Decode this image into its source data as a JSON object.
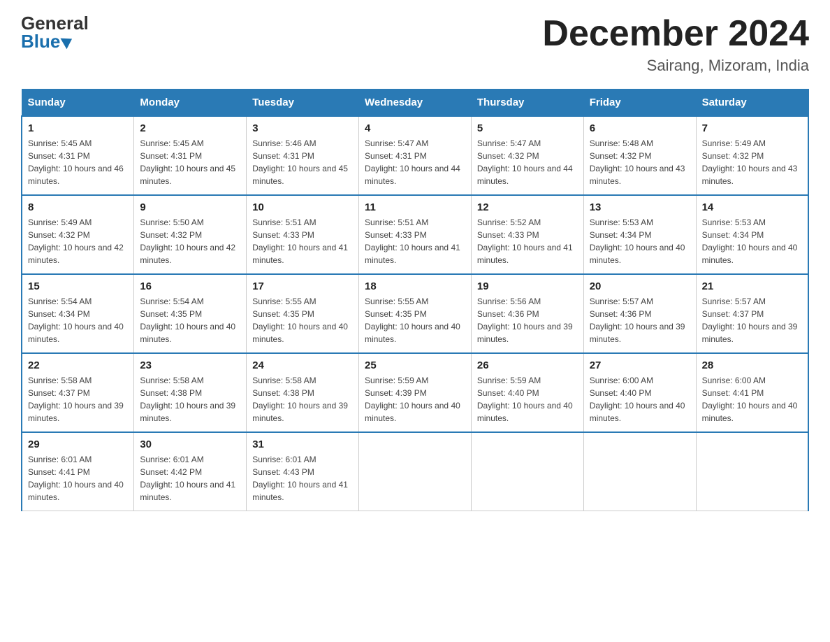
{
  "header": {
    "logo_line1": "General",
    "logo_line2": "Blue",
    "month_title": "December 2024",
    "location": "Sairang, Mizoram, India"
  },
  "weekdays": [
    "Sunday",
    "Monday",
    "Tuesday",
    "Wednesday",
    "Thursday",
    "Friday",
    "Saturday"
  ],
  "weeks": [
    [
      {
        "day": "1",
        "sunrise": "5:45 AM",
        "sunset": "4:31 PM",
        "daylight": "10 hours and 46 minutes."
      },
      {
        "day": "2",
        "sunrise": "5:45 AM",
        "sunset": "4:31 PM",
        "daylight": "10 hours and 45 minutes."
      },
      {
        "day": "3",
        "sunrise": "5:46 AM",
        "sunset": "4:31 PM",
        "daylight": "10 hours and 45 minutes."
      },
      {
        "day": "4",
        "sunrise": "5:47 AM",
        "sunset": "4:31 PM",
        "daylight": "10 hours and 44 minutes."
      },
      {
        "day": "5",
        "sunrise": "5:47 AM",
        "sunset": "4:32 PM",
        "daylight": "10 hours and 44 minutes."
      },
      {
        "day": "6",
        "sunrise": "5:48 AM",
        "sunset": "4:32 PM",
        "daylight": "10 hours and 43 minutes."
      },
      {
        "day": "7",
        "sunrise": "5:49 AM",
        "sunset": "4:32 PM",
        "daylight": "10 hours and 43 minutes."
      }
    ],
    [
      {
        "day": "8",
        "sunrise": "5:49 AM",
        "sunset": "4:32 PM",
        "daylight": "10 hours and 42 minutes."
      },
      {
        "day": "9",
        "sunrise": "5:50 AM",
        "sunset": "4:32 PM",
        "daylight": "10 hours and 42 minutes."
      },
      {
        "day": "10",
        "sunrise": "5:51 AM",
        "sunset": "4:33 PM",
        "daylight": "10 hours and 41 minutes."
      },
      {
        "day": "11",
        "sunrise": "5:51 AM",
        "sunset": "4:33 PM",
        "daylight": "10 hours and 41 minutes."
      },
      {
        "day": "12",
        "sunrise": "5:52 AM",
        "sunset": "4:33 PM",
        "daylight": "10 hours and 41 minutes."
      },
      {
        "day": "13",
        "sunrise": "5:53 AM",
        "sunset": "4:34 PM",
        "daylight": "10 hours and 40 minutes."
      },
      {
        "day": "14",
        "sunrise": "5:53 AM",
        "sunset": "4:34 PM",
        "daylight": "10 hours and 40 minutes."
      }
    ],
    [
      {
        "day": "15",
        "sunrise": "5:54 AM",
        "sunset": "4:34 PM",
        "daylight": "10 hours and 40 minutes."
      },
      {
        "day": "16",
        "sunrise": "5:54 AM",
        "sunset": "4:35 PM",
        "daylight": "10 hours and 40 minutes."
      },
      {
        "day": "17",
        "sunrise": "5:55 AM",
        "sunset": "4:35 PM",
        "daylight": "10 hours and 40 minutes."
      },
      {
        "day": "18",
        "sunrise": "5:55 AM",
        "sunset": "4:35 PM",
        "daylight": "10 hours and 40 minutes."
      },
      {
        "day": "19",
        "sunrise": "5:56 AM",
        "sunset": "4:36 PM",
        "daylight": "10 hours and 39 minutes."
      },
      {
        "day": "20",
        "sunrise": "5:57 AM",
        "sunset": "4:36 PM",
        "daylight": "10 hours and 39 minutes."
      },
      {
        "day": "21",
        "sunrise": "5:57 AM",
        "sunset": "4:37 PM",
        "daylight": "10 hours and 39 minutes."
      }
    ],
    [
      {
        "day": "22",
        "sunrise": "5:58 AM",
        "sunset": "4:37 PM",
        "daylight": "10 hours and 39 minutes."
      },
      {
        "day": "23",
        "sunrise": "5:58 AM",
        "sunset": "4:38 PM",
        "daylight": "10 hours and 39 minutes."
      },
      {
        "day": "24",
        "sunrise": "5:58 AM",
        "sunset": "4:38 PM",
        "daylight": "10 hours and 39 minutes."
      },
      {
        "day": "25",
        "sunrise": "5:59 AM",
        "sunset": "4:39 PM",
        "daylight": "10 hours and 40 minutes."
      },
      {
        "day": "26",
        "sunrise": "5:59 AM",
        "sunset": "4:40 PM",
        "daylight": "10 hours and 40 minutes."
      },
      {
        "day": "27",
        "sunrise": "6:00 AM",
        "sunset": "4:40 PM",
        "daylight": "10 hours and 40 minutes."
      },
      {
        "day": "28",
        "sunrise": "6:00 AM",
        "sunset": "4:41 PM",
        "daylight": "10 hours and 40 minutes."
      }
    ],
    [
      {
        "day": "29",
        "sunrise": "6:01 AM",
        "sunset": "4:41 PM",
        "daylight": "10 hours and 40 minutes."
      },
      {
        "day": "30",
        "sunrise": "6:01 AM",
        "sunset": "4:42 PM",
        "daylight": "10 hours and 41 minutes."
      },
      {
        "day": "31",
        "sunrise": "6:01 AM",
        "sunset": "4:43 PM",
        "daylight": "10 hours and 41 minutes."
      },
      null,
      null,
      null,
      null
    ]
  ]
}
